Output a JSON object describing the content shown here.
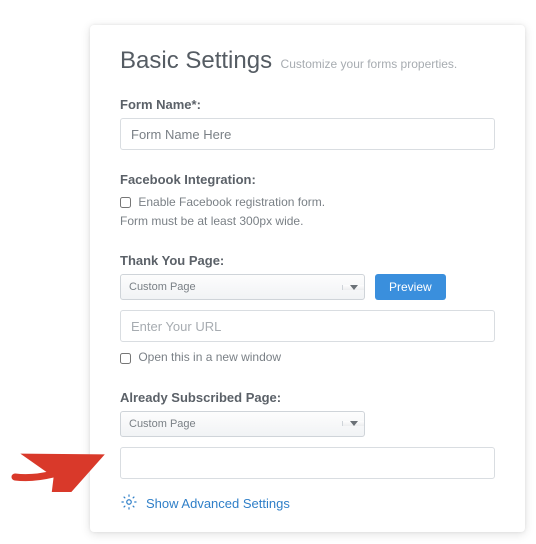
{
  "header": {
    "title": "Basic Settings",
    "subtitle": "Customize your forms properties."
  },
  "formName": {
    "label": "Form Name*:",
    "value": "Form Name Here"
  },
  "facebook": {
    "label": "Facebook Integration:",
    "checkbox_label": "Enable Facebook registration form.",
    "note": "Form must be at least 300px wide."
  },
  "thankYou": {
    "label": "Thank You Page:",
    "select_value": "Custom Page",
    "preview_button": "Preview",
    "url_placeholder": "Enter Your URL",
    "url_value": "",
    "new_window_label": "Open this in a new window"
  },
  "already": {
    "label": "Already Subscribed Page:",
    "select_value": "Custom Page",
    "url_value": ""
  },
  "advanced": {
    "label": "Show Advanced Settings"
  }
}
